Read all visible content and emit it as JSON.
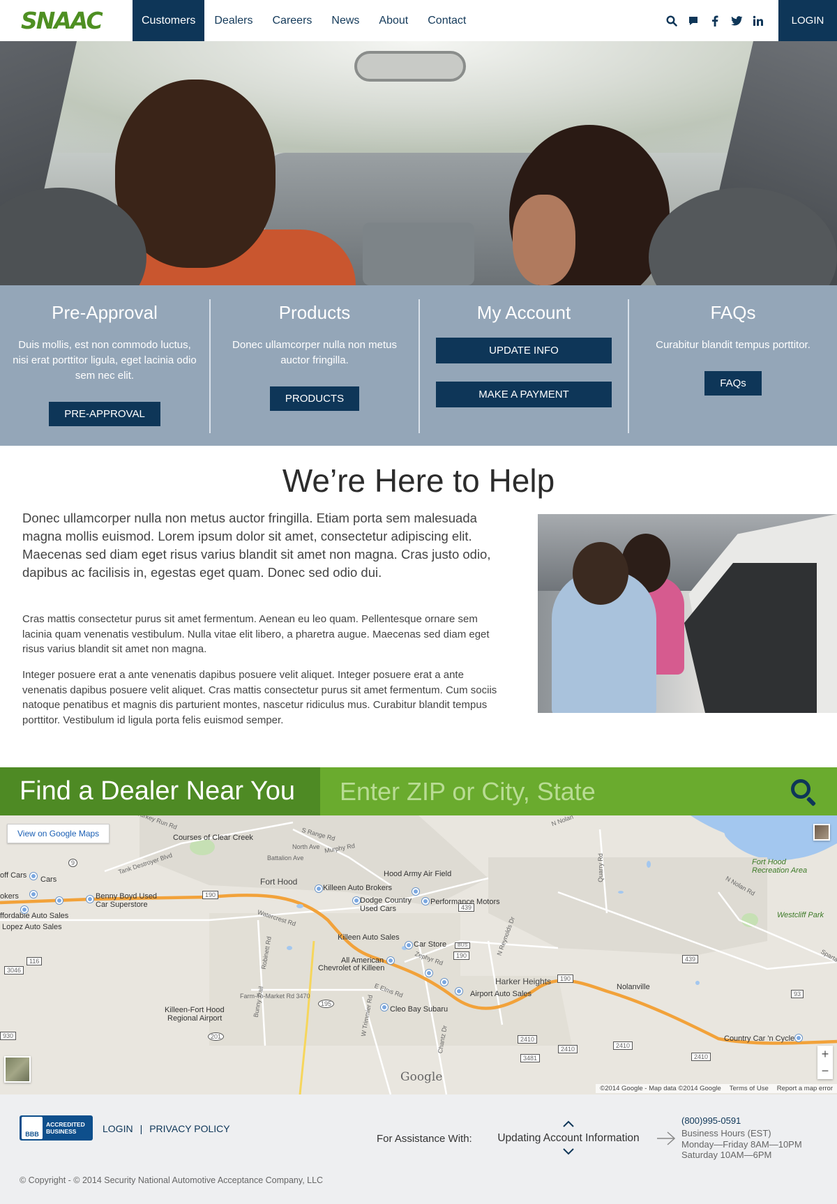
{
  "brand": {
    "logo_text": "SNAAC",
    "logo_color": "#4e8f22",
    "navy": "#0e3658",
    "green_dark": "#4e8a24",
    "green_light": "#6aab2e",
    "steel": "#94a6b8"
  },
  "nav": {
    "items": [
      "Customers",
      "Dealers",
      "Careers",
      "News",
      "About",
      "Contact"
    ],
    "active": "Customers",
    "icons": [
      "search-icon",
      "chat-icon",
      "facebook-icon",
      "twitter-icon",
      "linkedin-icon"
    ],
    "login_label": "LOGIN"
  },
  "features": {
    "preapproval": {
      "title": "Pre-Approval",
      "text": "Duis mollis, est non commodo luctus, nisi erat porttitor ligula, eget lacinia odio sem nec elit.",
      "button": "PRE-APPROVAL"
    },
    "products": {
      "title": "Products",
      "text": "Donec ullamcorper nulla non metus auctor fringilla.",
      "button": "PRODUCTS"
    },
    "account": {
      "title": "My Account",
      "button_update": "UPDATE INFO",
      "button_payment": "MAKE A PAYMENT"
    },
    "faqs": {
      "title": "FAQs",
      "text": "Curabitur blandit tempus porttitor.",
      "button": "FAQs"
    }
  },
  "help": {
    "title": "We’re Here to Help",
    "lead": "Donec ullamcorper nulla non metus auctor fringilla. Etiam porta sem malesuada magna mollis euismod. Lorem ipsum dolor sit amet, consectetur adipiscing elit. Maecenas sed diam eget risus varius blandit sit amet non magna. Cras justo odio, dapibus ac facilisis in, egestas eget quam. Donec sed odio dui.",
    "p1": "Cras mattis consectetur purus sit amet fermentum. Aenean eu leo quam. Pellentesque ornare sem lacinia quam venenatis vestibulum. Nulla vitae elit libero, a pharetra augue. Maecenas sed diam eget risus varius blandit sit amet non magna.",
    "p2": "Integer posuere erat a ante venenatis dapibus posuere velit aliquet. Integer posuere erat a ante venenatis dapibus posuere velit aliquet. Cras mattis consectetur purus sit amet fermentum. Cum sociis natoque penatibus et magnis dis parturient montes, nascetur ridiculus mus. Curabitur blandit tempus porttitor. Vestibulum id ligula porta felis euismod semper."
  },
  "dealer": {
    "label": "Find a Dealer Near You",
    "placeholder": "Enter ZIP or City, State"
  },
  "map": {
    "view_button": "View on Google Maps",
    "labels": {
      "turkey_run": "Turkey Run Rd",
      "s_range": "S Range Rd",
      "clear_creek": "Courses of Clear Creek",
      "north_ave": "North Ave",
      "murphy": "Murphy Rd",
      "battalion": "Battalion Ave",
      "tank_destroyer": "Tank Destroyer Blvd",
      "hood_field": "Hood Army Air Field",
      "fort_hood": "Fort Hood",
      "cars": "Cars",
      "off_cars": "off Cars",
      "okers": "okers",
      "benny_boyd": "Benny Boyd Used",
      "car_superstore": "Car Superstore",
      "killeen_brokers": "Killeen Auto Brokers",
      "dodge_country": "Dodge Country",
      "used_cars": "Used Cars",
      "performance": "Performance Motors",
      "affordable": "ffordable Auto Sales",
      "lopez": "Lopez Auto Sales",
      "watercrest": "Watercrest Rd",
      "killeen_auto": "Killeen Auto Sales",
      "car_store": "Car Store",
      "zephyr": "Zephyr Rd",
      "reynolds": "N Reynolds Dr",
      "all_american": "All American",
      "chevrolet": "Chevrolet of Killeen",
      "farm_market": "Farm-To-Market Rd 3470",
      "harker": "Harker Heights",
      "airport_auto": "Airport Auto Sales",
      "elms": "E Elms Rd",
      "cleo_bay": "Cleo Bay Subaru",
      "regional_1": "Killeen-Fort Hood",
      "regional_2": "Regional Airport",
      "nolanville": "Nolanville",
      "country_car": "Country Car 'n Cycle",
      "fort_hood_rec_1": "Fort Hood",
      "fort_hood_rec_2": "Recreation Area",
      "westcliff": "Westcliff Park",
      "n_nolan": "N Nolan Rd",
      "quarry": "Quarry Rd",
      "robinett": "Robinett Rd",
      "bunny": "Bunny Trail",
      "trimmier": "W Trimmier Rd",
      "chantz": "Chantz Dr",
      "sparta": "Sparta",
      "n_nolan_top": "N Nolan"
    },
    "shields": [
      "9",
      "190",
      "439",
      "190",
      "116",
      "3046",
      "195",
      "201",
      "930",
      "190",
      "439",
      "93",
      "2410",
      "2410",
      "2410",
      "3481",
      "2410",
      "BUS"
    ],
    "google_mark": "Google",
    "attribution": [
      "©2014 Google - Map data ©2014 Google",
      "Terms of Use",
      "Report a map error"
    ]
  },
  "footer": {
    "bbb_seal": "BBB",
    "bbb_line1": "ACCREDITED",
    "bbb_line2": "BUSINESS",
    "login": "LOGIN",
    "separator": "|",
    "privacy": "PRIVACY POLICY",
    "assist_label": "For Assistance With:",
    "assist_value": "Updating Account Information",
    "phone": "(800)995-0591",
    "hours_title": "Business Hours (EST)",
    "hours_weekday": "Monday—Friday 8AM—10PM",
    "hours_saturday": "Saturday 10AM—6PM",
    "copyright": "© Copyright - © 2014 Security National Automotive Acceptance Company, LLC"
  }
}
